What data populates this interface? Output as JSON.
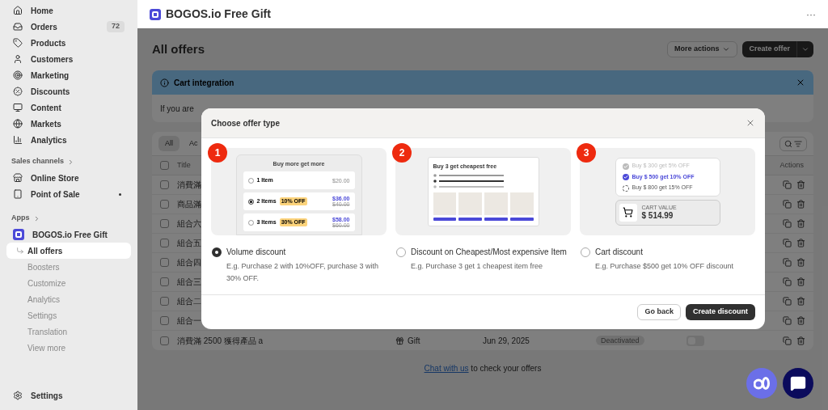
{
  "sidebar": {
    "nav": [
      {
        "label": "Home"
      },
      {
        "label": "Orders",
        "badge": "72"
      },
      {
        "label": "Products"
      },
      {
        "label": "Customers"
      },
      {
        "label": "Marketing"
      },
      {
        "label": "Discounts"
      },
      {
        "label": "Content"
      },
      {
        "label": "Markets"
      },
      {
        "label": "Analytics"
      }
    ],
    "sales_channels": {
      "heading": "Sales channels",
      "items": [
        {
          "label": "Online Store"
        },
        {
          "label": "Point of Sale"
        }
      ]
    },
    "apps": {
      "heading": "Apps",
      "app": "BOGOS.io Free Gift",
      "items": [
        {
          "label": "All offers",
          "selected": true
        },
        {
          "label": "Boosters",
          "selected": false
        },
        {
          "label": "Customize",
          "selected": false
        },
        {
          "label": "Analytics",
          "selected": false
        },
        {
          "label": "Settings",
          "selected": false
        },
        {
          "label": "Translation",
          "selected": false
        },
        {
          "label": "View more",
          "selected": false
        }
      ]
    },
    "settings": "Settings"
  },
  "app_bar": {
    "title": "BOGOS.io Free Gift",
    "menu": "···"
  },
  "page": {
    "title": "All offers",
    "more_actions": "More actions",
    "create": "Create offer"
  },
  "banner": {
    "title": "Cart integration",
    "text": "If you are"
  },
  "table": {
    "tabs": [
      {
        "label": "All",
        "selected": true
      },
      {
        "label": "Ac",
        "selected": false
      }
    ],
    "columns": [
      "Title",
      "Actions"
    ],
    "select_all_checked": false,
    "rows": [
      {
        "title": "消費滿",
        "checked": false
      },
      {
        "title": "商品滿",
        "checked": false
      },
      {
        "title": "組合六",
        "checked": false
      },
      {
        "title": "組合五",
        "checked": false
      },
      {
        "title": "組合四",
        "checked": false
      },
      {
        "title": "組合三",
        "checked": false
      },
      {
        "title": "組合二",
        "checked": false
      },
      {
        "title": "組合一",
        "checked": false
      },
      {
        "title": "消費滿 2500 獲得產品 a",
        "type": "Gift",
        "date": "Jun 29, 2025",
        "status": "Deactivated",
        "on": false,
        "checked": false
      }
    ]
  },
  "footer": {
    "link": "Chat with us",
    "text": "to check your offers"
  },
  "modal": {
    "title": "Choose offer type",
    "options": [
      {
        "number": "1",
        "kind": "volume",
        "label": "Volume discount",
        "description": "E.g. Purchase 2 with 10%OFF, purchase 3 with 30% OFF.",
        "selected": true,
        "preview": {
          "title": "Buy more get more",
          "rows": [
            {
              "label": "1 Item",
              "price": "$20.00",
              "selected": false
            },
            {
              "label": "2 Items",
              "tag": "10% OFF",
              "price": "$36.00",
              "old_price": "$40.00",
              "selected": true
            },
            {
              "label": "3 Items",
              "tag": "30% OFF",
              "price": "$58.00",
              "old_price": "$60.00",
              "selected": false
            }
          ]
        }
      },
      {
        "number": "2",
        "kind": "cheapest",
        "label": "Discount on Cheapest/Most expensive Item",
        "description": "E.g. Purchase 3 get 1 cheapest item free",
        "selected": false,
        "preview": {
          "title": "Buy 3 get cheapest free"
        }
      },
      {
        "number": "3",
        "kind": "cart",
        "label": "Cart discount",
        "description": "E.g. Purchase $500 get 10% OFF discount",
        "selected": false,
        "preview": {
          "tiers": [
            {
              "label": "Buy $ 300 get 5% OFF",
              "kind": "done"
            },
            {
              "label": "Buy $ 500 get 10% OFF",
              "kind": "active"
            },
            {
              "label": "Buy $ 800 get 15% OFF",
              "kind": "pending"
            }
          ],
          "cart_label": "CART VALUE",
          "cart_value": "$ 514.99"
        }
      }
    ],
    "buttons": {
      "back": "Go back",
      "confirm": "Create discount"
    }
  }
}
